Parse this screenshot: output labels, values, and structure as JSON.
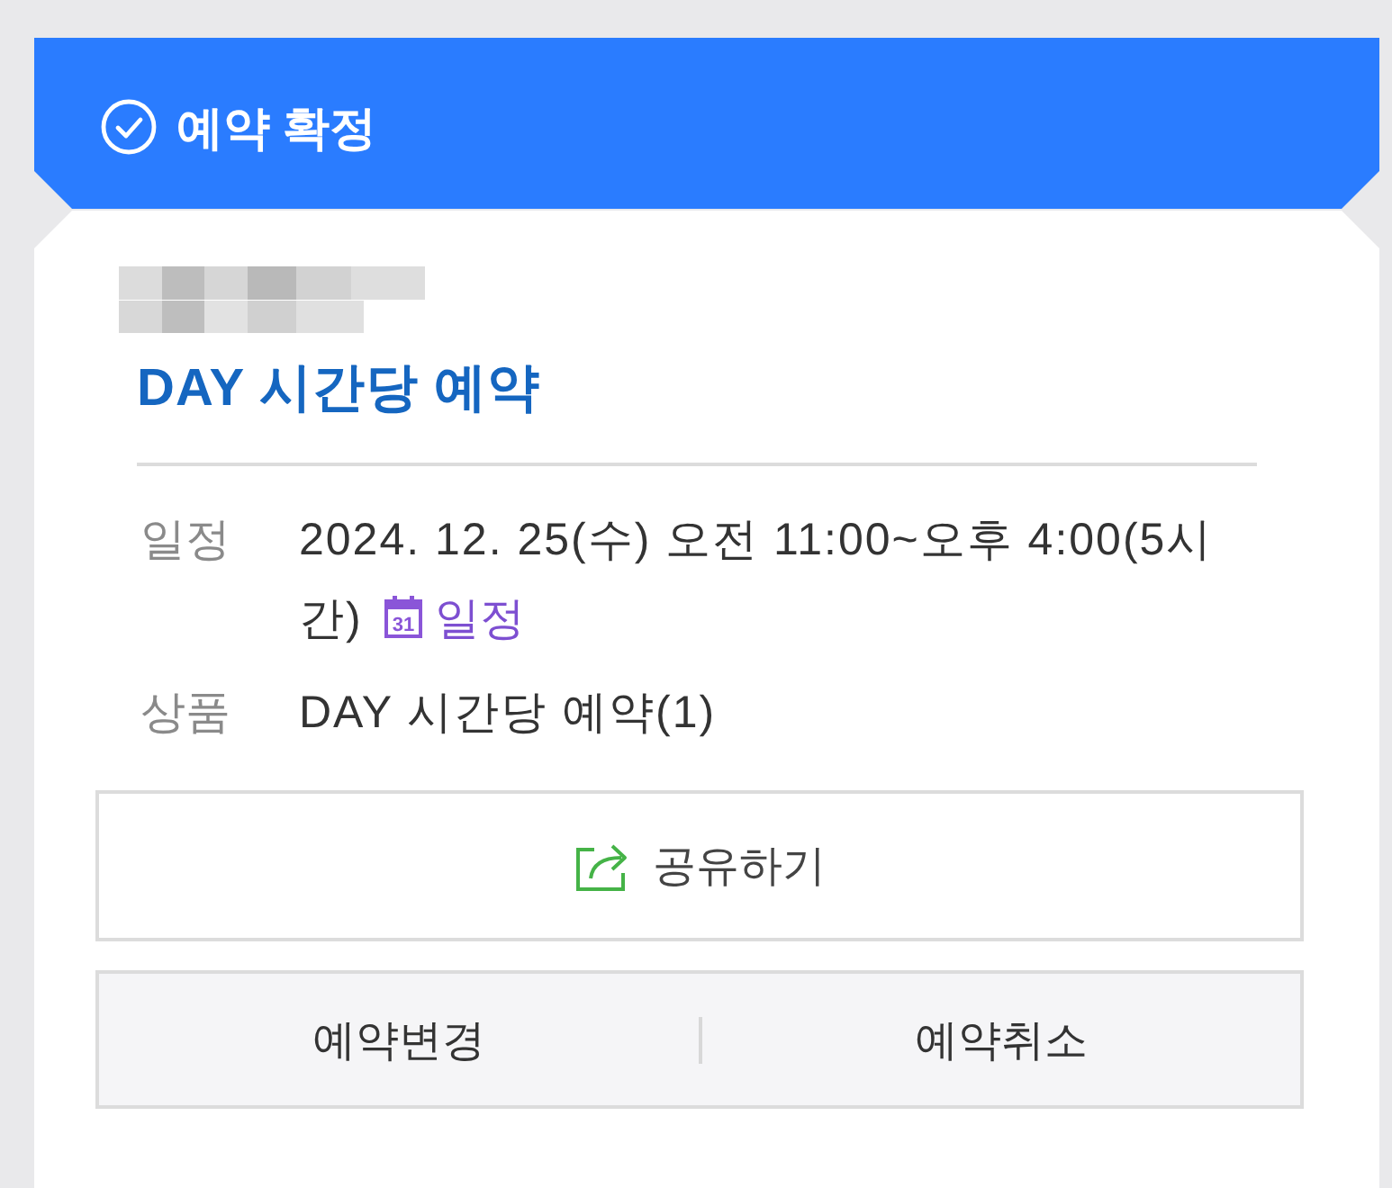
{
  "header": {
    "title": "예약 확정"
  },
  "booking": {
    "title": "DAY 시간당 예약",
    "details": [
      {
        "label": "일정",
        "value": "2024. 12. 25(수) 오전 11:00~오후 4:00(5시간)",
        "calendar_link": {
          "day": "31",
          "label": "일정"
        }
      },
      {
        "label": "상품",
        "value": "DAY 시간당 예약(1)"
      }
    ]
  },
  "share_button": {
    "label": "공유하기"
  },
  "actions": [
    {
      "label": "예약변경"
    },
    {
      "label": "예약취소"
    }
  ]
}
